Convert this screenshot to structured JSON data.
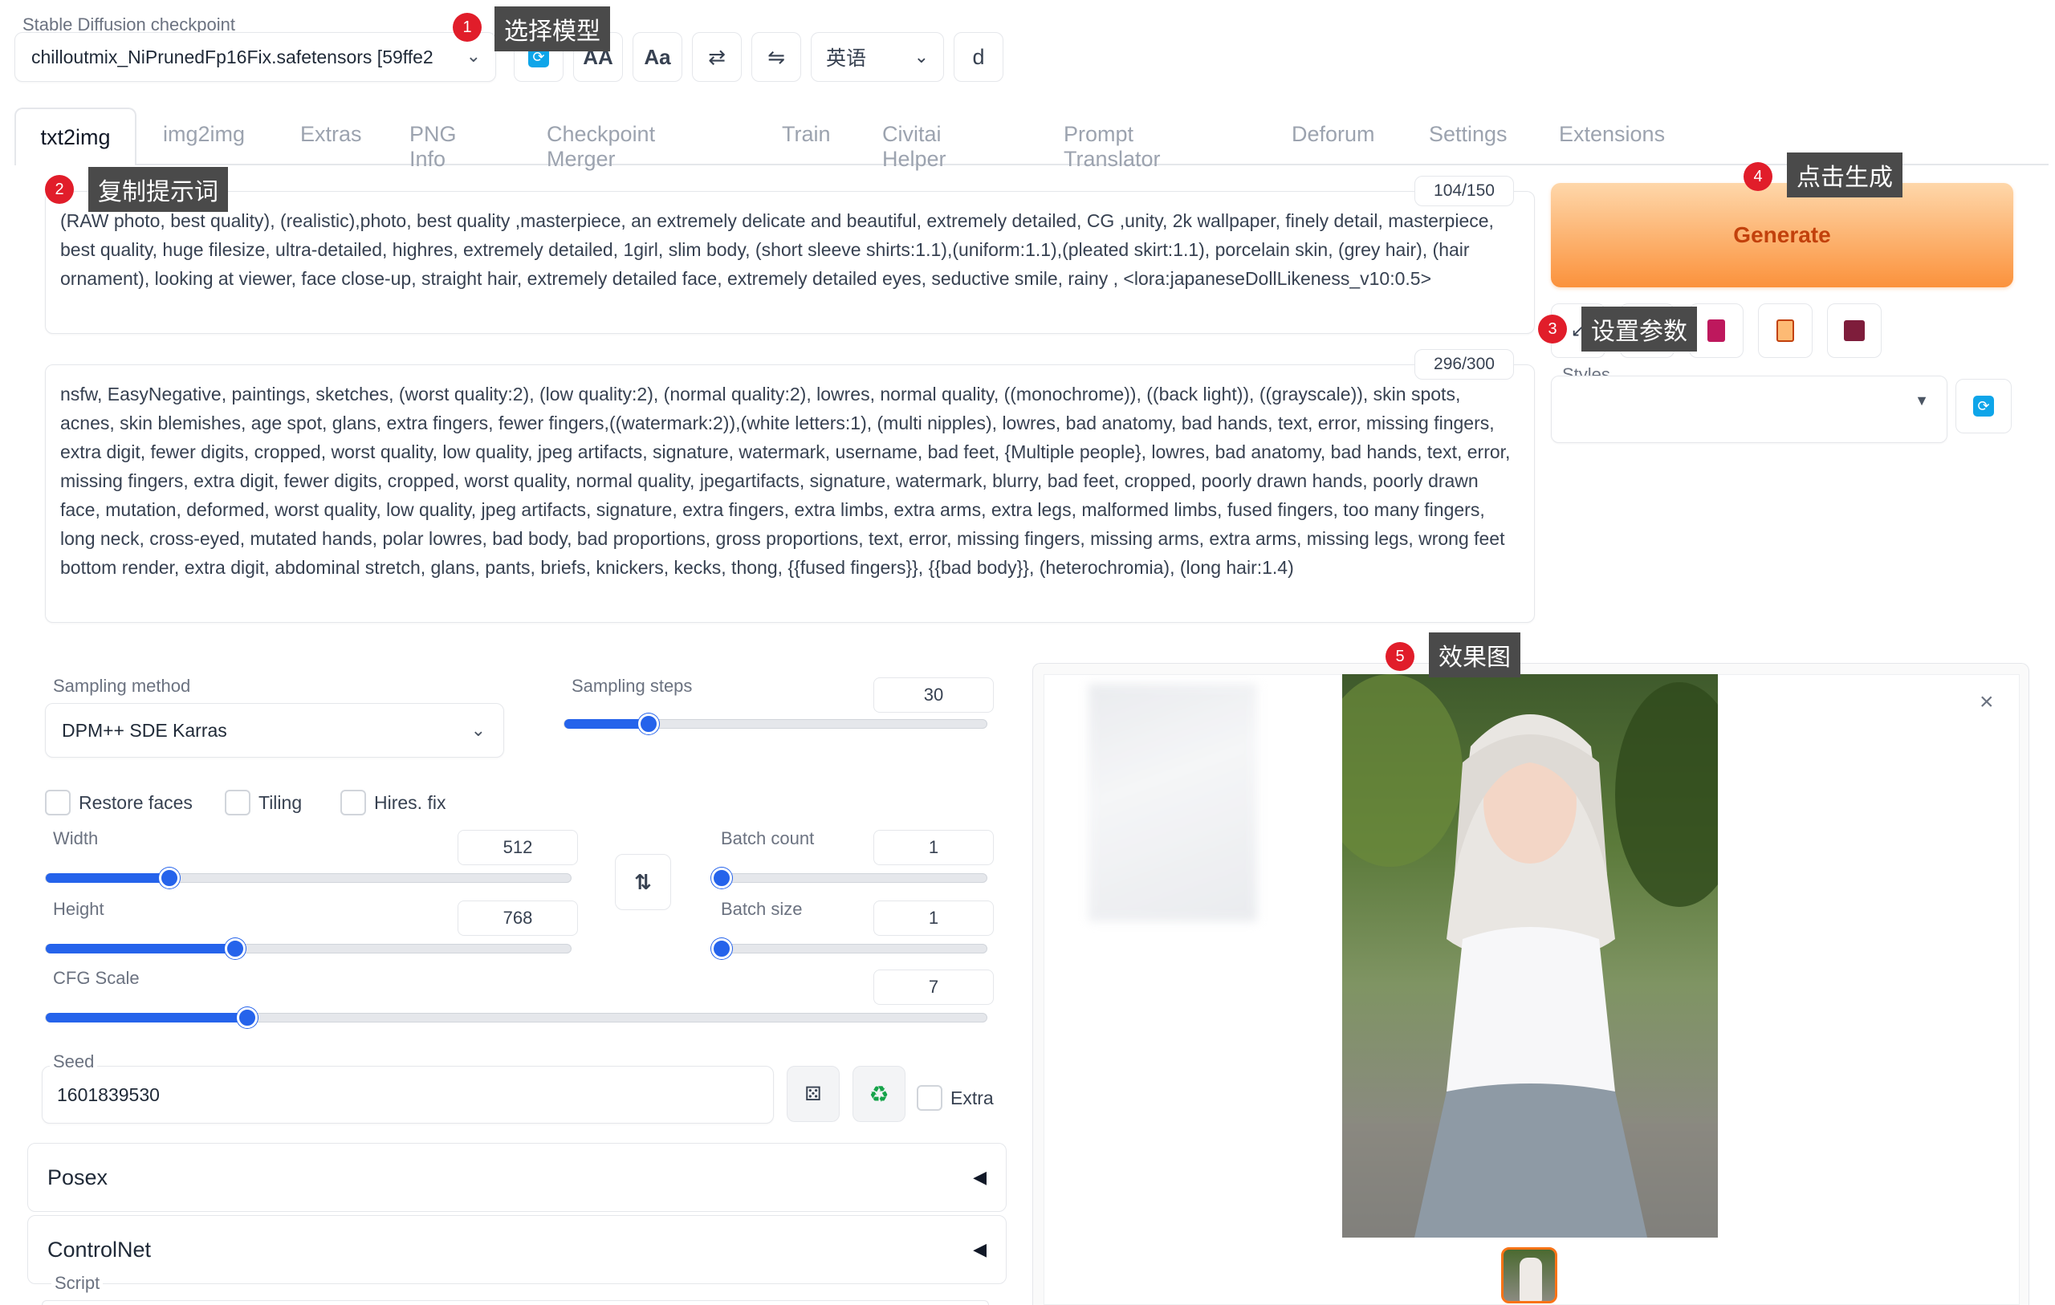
{
  "checkpoint": {
    "label": "Stable Diffusion checkpoint",
    "value": "chilloutmix_NiPrunedFp16Fix.safetensors [59ffe2"
  },
  "toolbar": {
    "language_value": "英语",
    "d_button_label": "d"
  },
  "tabs": [
    "txt2img",
    "img2img",
    "Extras",
    "PNG Info",
    "Checkpoint Merger",
    "Train",
    "Civitai Helper",
    "Prompt Translator",
    "Deforum",
    "Settings",
    "Extensions"
  ],
  "active_tab": "txt2img",
  "prompt": {
    "counter": "104/150",
    "text": "(RAW photo, best quality), (realistic),photo, best quality ,masterpiece, an extremely delicate and beautiful, extremely detailed, CG ,unity, 2k wallpaper, finely detail, masterpiece, best quality, huge filesize, ultra-detailed, highres, extremely detailed, 1girl, slim body, (short sleeve shirts:1.1),(uniform:1.1),(pleated skirt:1.1), porcelain skin, (grey hair), (hair ornament), looking at viewer, face close-up, straight hair, extremely detailed face, extremely detailed eyes, seductive smile, rainy , <lora:japaneseDollLikeness_v10:0.5>"
  },
  "negative_prompt": {
    "counter": "296/300",
    "text": "nsfw, EasyNegative, paintings, sketches, (worst quality:2), (low quality:2), (normal quality:2), lowres, normal quality, ((monochrome)), ((back light)), ((grayscale)), skin spots, acnes, skin blemishes, age spot, glans, extra fingers, fewer fingers,((watermark:2)),(white letters:1), (multi nipples), lowres, bad anatomy, bad hands, text, error, missing fingers, extra digit, fewer digits, cropped, worst quality, low quality, jpeg artifacts, signature, watermark, username, bad feet, {Multiple people}, lowres, bad anatomy, bad hands, text, error, missing fingers, extra digit, fewer digits, cropped, worst quality, normal quality, jpegartifacts, signature, watermark, blurry, bad feet, cropped, poorly drawn hands, poorly drawn face, mutation, deformed, worst quality, low quality, jpeg artifacts, signature, extra fingers, extra limbs, extra arms, extra legs, malformed limbs, fused fingers, too many fingers, long neck, cross-eyed, mutated hands, polar lowres, bad body, bad proportions, gross proportions, text, error, missing fingers, missing arms, extra arms, missing legs, wrong feet bottom render, extra digit, abdominal stretch, glans, pants, briefs, knickers, kecks, thong, {{fused fingers}}, {{bad body}}, (heterochromia), (long hair:1.4)"
  },
  "generate": {
    "label": "Generate"
  },
  "styles": {
    "label": "Styles",
    "value": ""
  },
  "sampling": {
    "method_label": "Sampling method",
    "method_value": "DPM++ SDE Karras",
    "steps_label": "Sampling steps",
    "steps_value": "30",
    "steps_fraction": 0.2
  },
  "checkboxes": {
    "restore_faces": "Restore faces",
    "tiling": "Tiling",
    "hires_fix": "Hires. fix"
  },
  "width": {
    "label": "Width",
    "value": "512",
    "fraction": 0.236
  },
  "height": {
    "label": "Height",
    "value": "768",
    "fraction": 0.361
  },
  "batch_count": {
    "label": "Batch count",
    "value": "1",
    "fraction": 0.0
  },
  "batch_size": {
    "label": "Batch size",
    "value": "1",
    "fraction": 0.0
  },
  "cfg": {
    "label": "CFG Scale",
    "value": "7",
    "fraction": 0.214
  },
  "seed": {
    "label": "Seed",
    "value": "1601839530",
    "extra_label": "Extra"
  },
  "accordions": {
    "posex": "Posex",
    "controlnet": "ControlNet"
  },
  "script_label": "Script",
  "annotations": {
    "a1": {
      "num": "1",
      "text": "选择模型"
    },
    "a2": {
      "num": "2",
      "text": "复制提示词"
    },
    "a3": {
      "num": "3",
      "text": "设置参数"
    },
    "a4": {
      "num": "4",
      "text": "点击生成"
    },
    "a5": {
      "num": "5",
      "text": "效果图"
    }
  },
  "colors": {
    "accent": "#2563eb",
    "generate_from": "#fdba74",
    "generate_to": "#fb923c",
    "generate_text": "#c2410c",
    "badge": "#e11d2a"
  }
}
